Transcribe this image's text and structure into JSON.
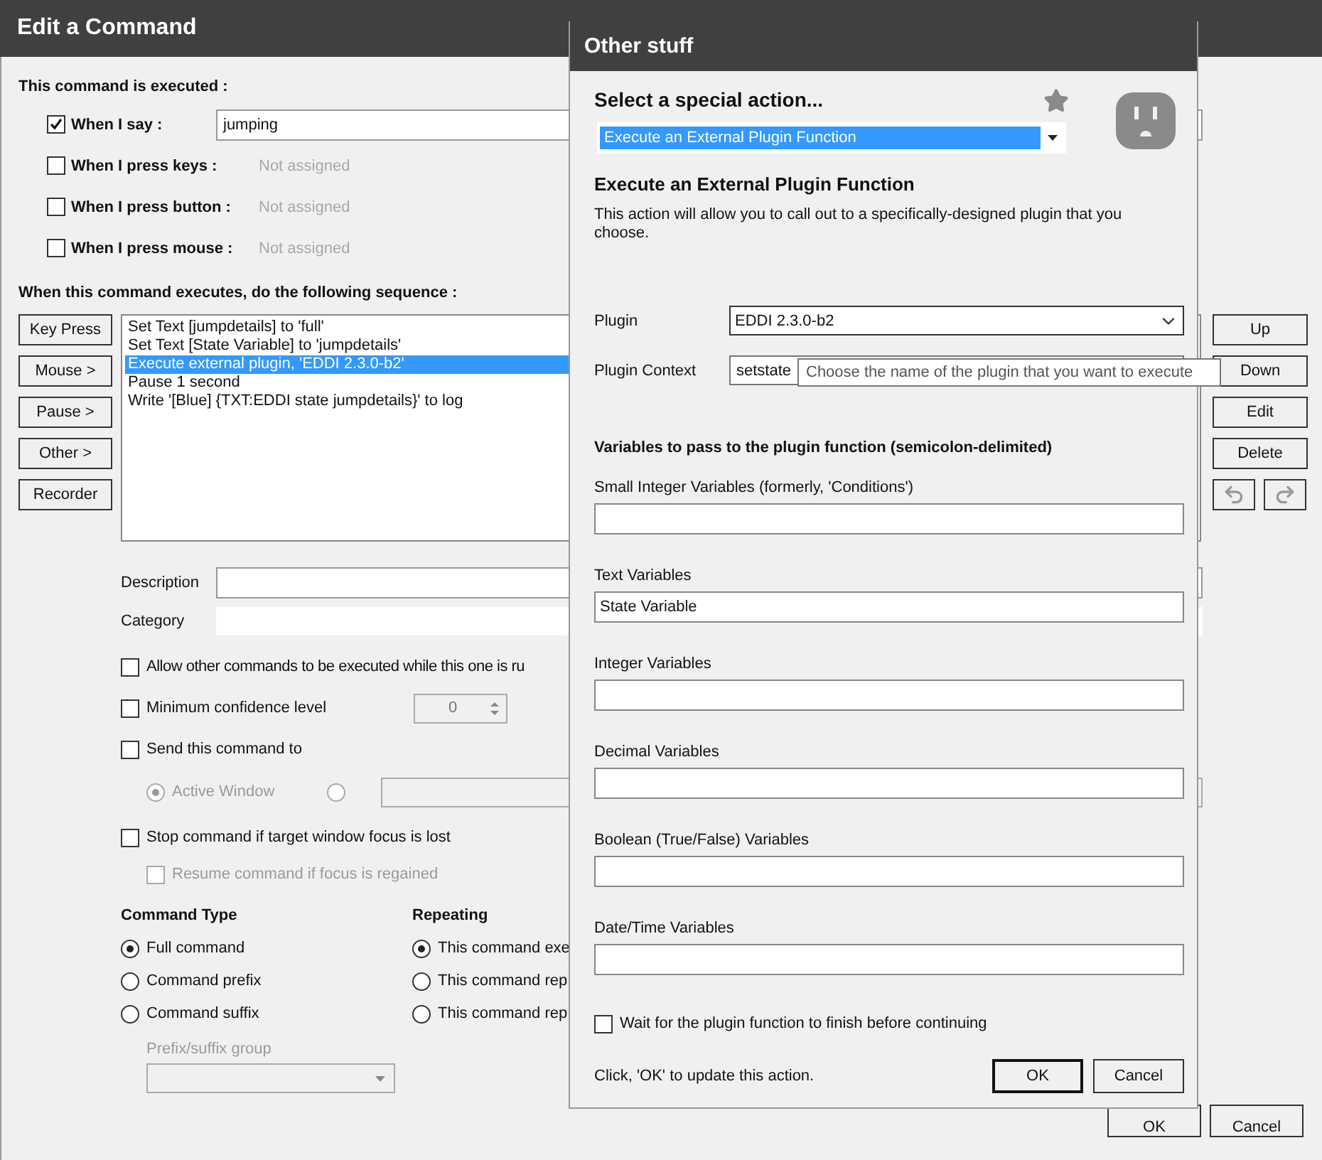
{
  "main_window": {
    "title": "Edit a Command",
    "trigger_heading": "This command is executed :",
    "triggers": [
      {
        "label": "When I say :",
        "checked": true,
        "kind": "field",
        "value": "jumping"
      },
      {
        "label": "When I press keys :",
        "checked": false,
        "kind": "hint",
        "value": "Not assigned"
      },
      {
        "label": "When I press button :",
        "checked": false,
        "kind": "hint",
        "value": "Not assigned"
      },
      {
        "label": "When I press mouse :",
        "checked": false,
        "kind": "hint",
        "value": "Not assigned"
      }
    ],
    "sequence_heading": "When this command executes, do the following sequence :",
    "sequence_buttons": [
      "Key Press",
      "Mouse >",
      "Pause >",
      "Other >",
      "Recorder"
    ],
    "sequence": [
      {
        "text": "Set Text [jumpdetails] to 'full'",
        "selected": false
      },
      {
        "text": "Set Text [State Variable] to 'jumpdetails'",
        "selected": false
      },
      {
        "text": "Execute external plugin, 'EDDI 2.3.0-b2'",
        "selected": true
      },
      {
        "text": "Pause 1 second",
        "selected": false
      },
      {
        "text": "Write '[Blue] {TXT:EDDI state jumpdetails}' to log",
        "selected": false
      }
    ],
    "description_label": "Description",
    "category_label": "Category",
    "options": [
      {
        "label": "Allow other commands to be executed while this one is ru",
        "checked": false
      },
      {
        "label": "Minimum confidence level",
        "checked": false,
        "kind": "spin",
        "value": "0"
      },
      {
        "label": "Send this command to",
        "checked": false
      }
    ],
    "send_targets": {
      "disabled": true,
      "items": [
        {
          "label": "Active Window",
          "selected": true
        },
        {
          "selected": false
        }
      ]
    },
    "stop_option": {
      "label": "Stop command if target window focus is lost",
      "checked": false
    },
    "resume_option": {
      "label": "Resume command if focus is regained",
      "checked": false,
      "disabled": true
    },
    "command_type": {
      "heading": "Command Type",
      "options": [
        {
          "label": "Full command",
          "selected": true
        },
        {
          "label": "Command prefix",
          "selected": false
        },
        {
          "label": "Command suffix",
          "selected": false
        }
      ]
    },
    "repeating": {
      "heading": "Repeating",
      "options": [
        {
          "label": "This command exe",
          "selected": true
        },
        {
          "label": "This command rep",
          "selected": false
        },
        {
          "label": "This command rep",
          "selected": false
        }
      ]
    },
    "prefix_group": {
      "label": "Prefix/suffix group",
      "disabled": true
    },
    "side_buttons": [
      "Up",
      "Down",
      "Edit",
      "Delete"
    ],
    "footer_buttons": [
      "OK",
      "Cancel"
    ]
  },
  "dialog": {
    "title": "Other stuff",
    "action_heading": "Select a special action...",
    "action": "Execute an External Plugin Function",
    "section_title": "Execute an External Plugin Function",
    "description": "This action will allow you to call out to a specifically-designed plugin that you choose.",
    "plugin": {
      "label": "Plugin",
      "value": "EDDI 2.3.0-b2"
    },
    "plugin_context": {
      "label": "Plugin Context",
      "value": "setstate"
    },
    "tooltip": "Choose the name of the plugin that you want to execute",
    "variables_heading": "Variables to pass to the plugin function (semicolon-delimited)",
    "variables": [
      {
        "label": "Small Integer Variables (formerly, 'Conditions')"
      },
      {
        "label": "Text Variables",
        "value": "State Variable"
      },
      {
        "label": "Integer Variables"
      },
      {
        "label": "Decimal Variables"
      },
      {
        "label": "Boolean (True/False) Variables"
      },
      {
        "label": "Date/Time Variables"
      }
    ],
    "wait_option": {
      "label": "Wait for the plugin function to finish before continuing",
      "checked": false
    },
    "hint": "Click, 'OK' to update this action.",
    "buttons": [
      {
        "label": "OK",
        "default": true
      },
      {
        "label": "Cancel",
        "default": false
      }
    ]
  }
}
